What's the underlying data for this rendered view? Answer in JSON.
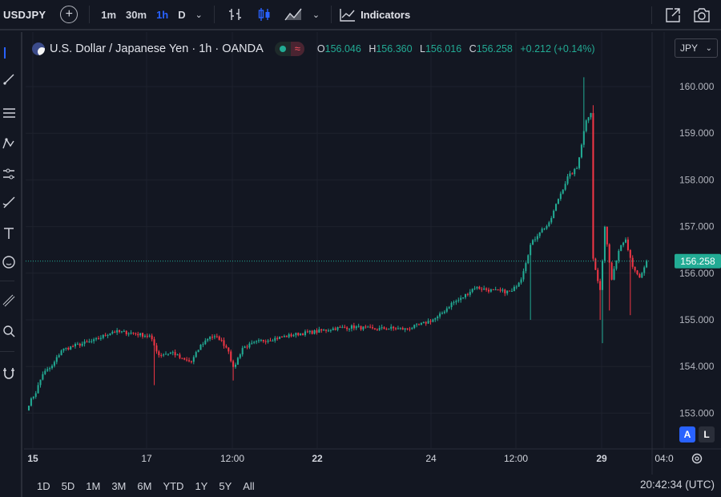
{
  "toolbar": {
    "symbol": "USDJPY",
    "compare_icon": "plus-circle-icon",
    "intervals": [
      "1m",
      "30m",
      "1h",
      "D"
    ],
    "active_interval": "1h",
    "indicators_label": "Indicators",
    "icons": [
      "bar-style-icon",
      "candles-icon",
      "area-icon",
      "indicators-icon",
      "snapshot-icon",
      "camera-icon"
    ]
  },
  "left_tools": [
    "cursor-icon",
    "trend-line-icon",
    "fib-icon",
    "pattern-icon",
    "prediction-icon",
    "brush-icon",
    "text-icon",
    "emoji-icon",
    "ruler-icon",
    "zoom-icon",
    "magnet-icon"
  ],
  "legend": {
    "title": "U.S. Dollar / Japanese Yen · 1h · OANDA",
    "open_label": "O",
    "open": "156.046",
    "high_label": "H",
    "high": "156.360",
    "low_label": "L",
    "low": "156.016",
    "close_label": "C",
    "close": "156.258",
    "change": "+0.212 (+0.14%)"
  },
  "currency_button": "JPY",
  "price_scale": {
    "labels": [
      "160.000",
      "159.000",
      "158.000",
      "157.000",
      "156.000",
      "155.000",
      "154.000",
      "153.000"
    ],
    "current_price": "156.258",
    "auto_button": "A",
    "log_button": "L"
  },
  "time_axis": {
    "labels": [
      "15",
      "17",
      "12:00",
      "22",
      "24",
      "12:00",
      "29",
      "04:0"
    ],
    "bold": [
      true,
      false,
      false,
      true,
      false,
      false,
      true,
      false
    ]
  },
  "bottom_bar": {
    "ranges": [
      "1D",
      "5D",
      "1M",
      "3M",
      "6M",
      "YTD",
      "1Y",
      "5Y",
      "All"
    ],
    "clock": "20:42:34 (UTC)"
  },
  "colors": {
    "up": "#22ab94",
    "down": "#f23645",
    "background": "#131722",
    "accent": "#2962ff"
  },
  "chart_data": {
    "type": "candlestick",
    "symbol": "USDJPY",
    "interval": "1h",
    "ylim": [
      152.8,
      160.5
    ],
    "current_price": 156.258,
    "anchors": [
      [
        0,
        153.2
      ],
      [
        3,
        153.45
      ],
      [
        6,
        153.85
      ],
      [
        10,
        154.0
      ],
      [
        14,
        154.35
      ],
      [
        20,
        154.45
      ],
      [
        28,
        154.55
      ],
      [
        36,
        154.75
      ],
      [
        44,
        154.72
      ],
      [
        52,
        154.65
      ],
      [
        56,
        154.25
      ],
      [
        62,
        154.3
      ],
      [
        66,
        154.15
      ],
      [
        70,
        154.1
      ],
      [
        74,
        154.45
      ],
      [
        78,
        154.65
      ],
      [
        82,
        154.6
      ],
      [
        86,
        154.35
      ],
      [
        88,
        153.95
      ],
      [
        92,
        154.4
      ],
      [
        100,
        154.55
      ],
      [
        108,
        154.62
      ],
      [
        116,
        154.7
      ],
      [
        124,
        154.75
      ],
      [
        132,
        154.82
      ],
      [
        140,
        154.85
      ],
      [
        148,
        154.8
      ],
      [
        156,
        154.82
      ],
      [
        162,
        154.8
      ],
      [
        168,
        154.88
      ],
      [
        176,
        155.05
      ],
      [
        182,
        155.35
      ],
      [
        186,
        155.45
      ],
      [
        192,
        155.7
      ],
      [
        200,
        155.62
      ],
      [
        208,
        155.6
      ],
      [
        212,
        155.9
      ],
      [
        216,
        156.6
      ],
      [
        220,
        156.9
      ],
      [
        224,
        157.05
      ],
      [
        228,
        157.6
      ],
      [
        232,
        158.05
      ],
      [
        236,
        158.25
      ],
      [
        240,
        159.3
      ],
      [
        242,
        159.45
      ],
      [
        243,
        156.3
      ],
      [
        246,
        155.6
      ],
      [
        248,
        157.0
      ],
      [
        251,
        155.9
      ],
      [
        254,
        156.5
      ],
      [
        257,
        156.7
      ],
      [
        260,
        156.1
      ],
      [
        263,
        155.9
      ],
      [
        266,
        156.25
      ]
    ]
  }
}
